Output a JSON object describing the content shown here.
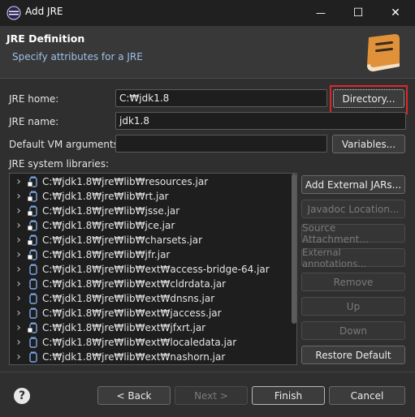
{
  "window": {
    "title": "Add JRE",
    "minimize_glyph": "—",
    "maximize_glyph": "☐",
    "close_glyph": "✕"
  },
  "header": {
    "title": "JRE Definition",
    "subtitle": "Specify attributes for a JRE",
    "icon": "book-icon"
  },
  "form": {
    "jre_home_label": "JRE home:",
    "jre_home_value": "C:₩jdk1.8",
    "directory_button": "Directory...",
    "jre_name_label": "JRE name:",
    "jre_name_value": "jdk1.8",
    "vm_args_label": "Default VM arguments:",
    "vm_args_value": "",
    "variables_button": "Variables...",
    "libraries_label": "JRE system libraries:"
  },
  "libraries": [
    {
      "path": "C:₩jdk1.8₩jre₩lib₩resources.jar",
      "icon": "jar-source-icon"
    },
    {
      "path": "C:₩jdk1.8₩jre₩lib₩rt.jar",
      "icon": "jar-source-icon"
    },
    {
      "path": "C:₩jdk1.8₩jre₩lib₩jsse.jar",
      "icon": "jar-source-icon"
    },
    {
      "path": "C:₩jdk1.8₩jre₩lib₩jce.jar",
      "icon": "jar-source-icon"
    },
    {
      "path": "C:₩jdk1.8₩jre₩lib₩charsets.jar",
      "icon": "jar-source-icon"
    },
    {
      "path": "C:₩jdk1.8₩jre₩lib₩jfr.jar",
      "icon": "jar-source-icon"
    },
    {
      "path": "C:₩jdk1.8₩jre₩lib₩ext₩access-bridge-64.jar",
      "icon": "jar-icon"
    },
    {
      "path": "C:₩jdk1.8₩jre₩lib₩ext₩cldrdata.jar",
      "icon": "jar-icon"
    },
    {
      "path": "C:₩jdk1.8₩jre₩lib₩ext₩dnsns.jar",
      "icon": "jar-icon"
    },
    {
      "path": "C:₩jdk1.8₩jre₩lib₩ext₩jaccess.jar",
      "icon": "jar-icon"
    },
    {
      "path": "C:₩jdk1.8₩jre₩lib₩ext₩jfxrt.jar",
      "icon": "jar-source-icon"
    },
    {
      "path": "C:₩jdk1.8₩jre₩lib₩ext₩localedata.jar",
      "icon": "jar-icon"
    },
    {
      "path": "C:₩jdk1.8₩jre₩lib₩ext₩nashorn.jar",
      "icon": "jar-icon"
    }
  ],
  "side_buttons": {
    "add_external_jars": "Add External JARs...",
    "javadoc_location": "Javadoc Location...",
    "source_attachment": "Source Attachment...",
    "external_annotations": "External annotations...",
    "remove": "Remove",
    "up": "Up",
    "down": "Down",
    "restore_default": "Restore Default"
  },
  "footer": {
    "help": "?",
    "back": "< Back",
    "next": "Next >",
    "finish": "Finish",
    "cancel": "Cancel"
  },
  "colors": {
    "highlight": "#e0262b",
    "book": "#e0913a",
    "subtitle": "#9ec0e8"
  }
}
